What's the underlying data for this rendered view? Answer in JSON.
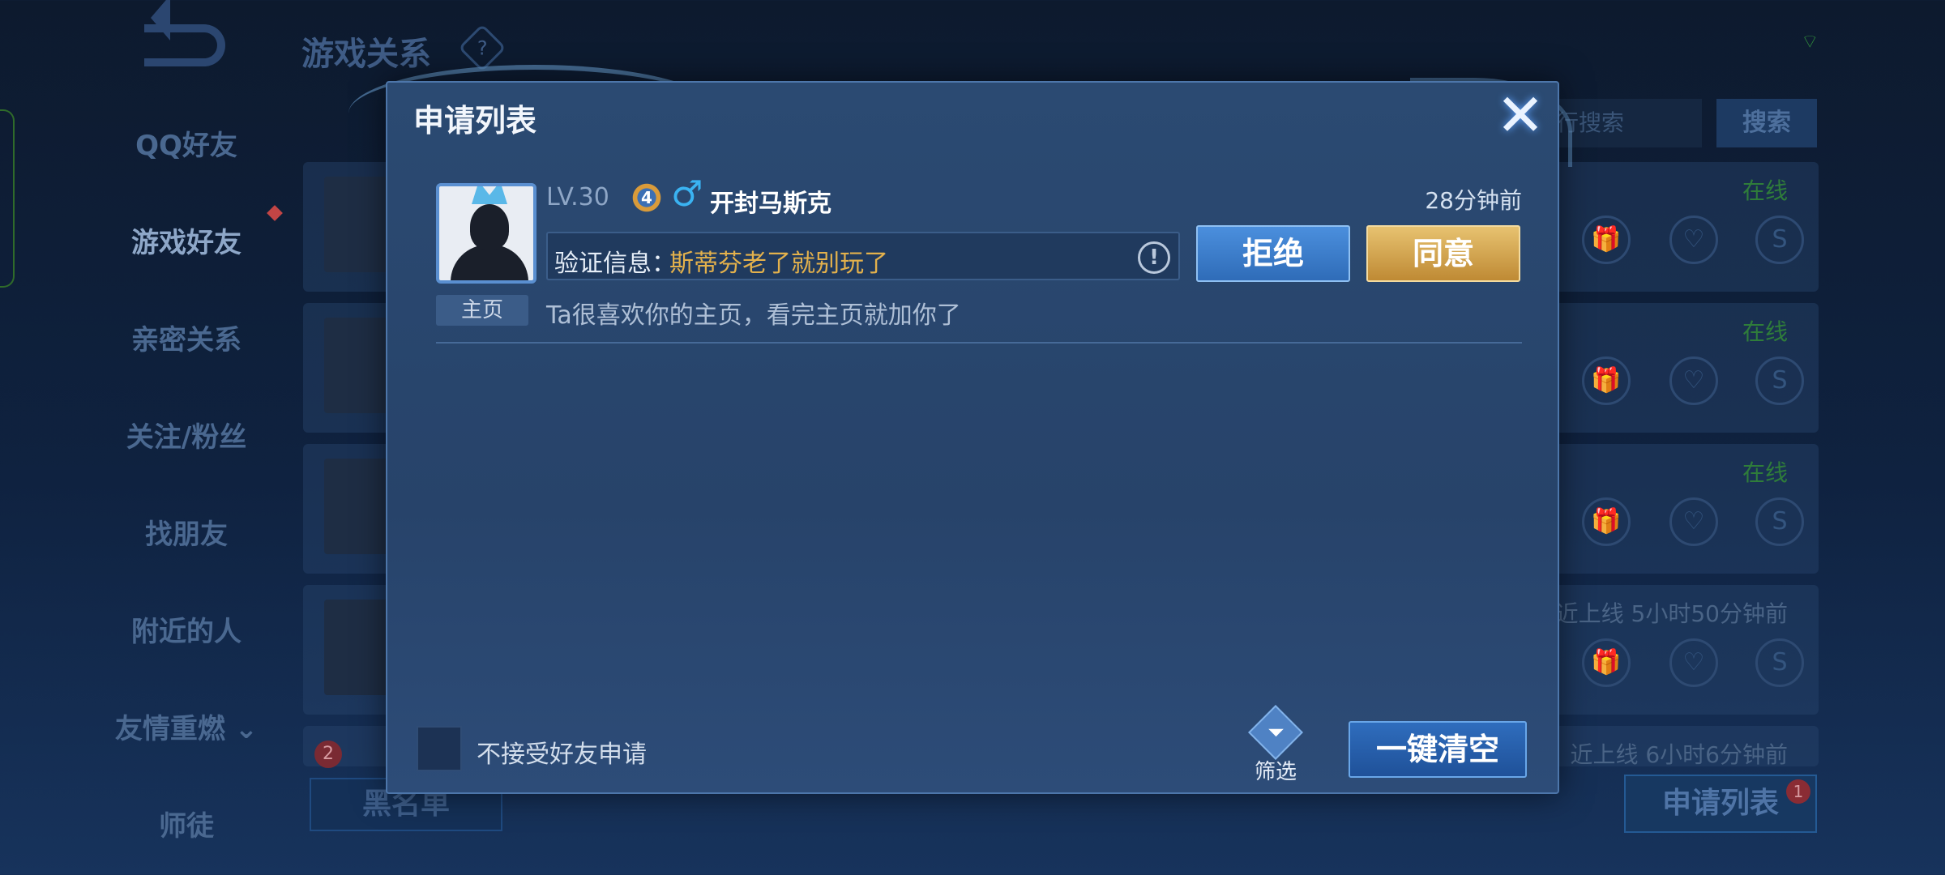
{
  "background": {
    "page_title": "游戏关系",
    "help_icon": "?",
    "sidebar": [
      {
        "label": "QQ好友"
      },
      {
        "label": "游戏好友"
      },
      {
        "label": "亲密关系"
      },
      {
        "label": "关注/粉丝"
      },
      {
        "label": "找朋友"
      },
      {
        "label": "附近的人"
      },
      {
        "label": "友情重燃 ⌄"
      },
      {
        "label": "师徒"
      }
    ],
    "search_placeholder": "行搜索",
    "search_button": "搜索",
    "friend_rows": [
      {
        "status": "在线"
      },
      {
        "status": "在线"
      },
      {
        "status": "在线"
      },
      {
        "status": "近上线  5小时50分钟前"
      },
      {
        "status": "近上线  6小时6分钟前"
      }
    ],
    "blacklist_button": "黑名单",
    "apply_list_button": "申请列表",
    "apply_badge": "1",
    "row_badge": "2"
  },
  "dialog": {
    "title": "申请列表",
    "close_icon": "✕",
    "request": {
      "level": "LV.30",
      "rank": "4",
      "gender_icon": "♂",
      "name": "开封马斯克",
      "time": "28分钟前",
      "verify_label": "验证信息：",
      "verify_text": "斯蒂芬老了就别玩了",
      "reject_label": "拒绝",
      "accept_label": "同意",
      "home_tag": "主页",
      "home_text": "Ta很喜欢你的主页，看完主页就加你了"
    },
    "checkbox_label": "不接受好友申请",
    "filter_label": "筛选",
    "clear_button": "一键清空"
  },
  "colors": {
    "accent_blue": "#2f6cb8",
    "accent_gold": "#bf8a34",
    "verify_text": "#e3b14c"
  }
}
